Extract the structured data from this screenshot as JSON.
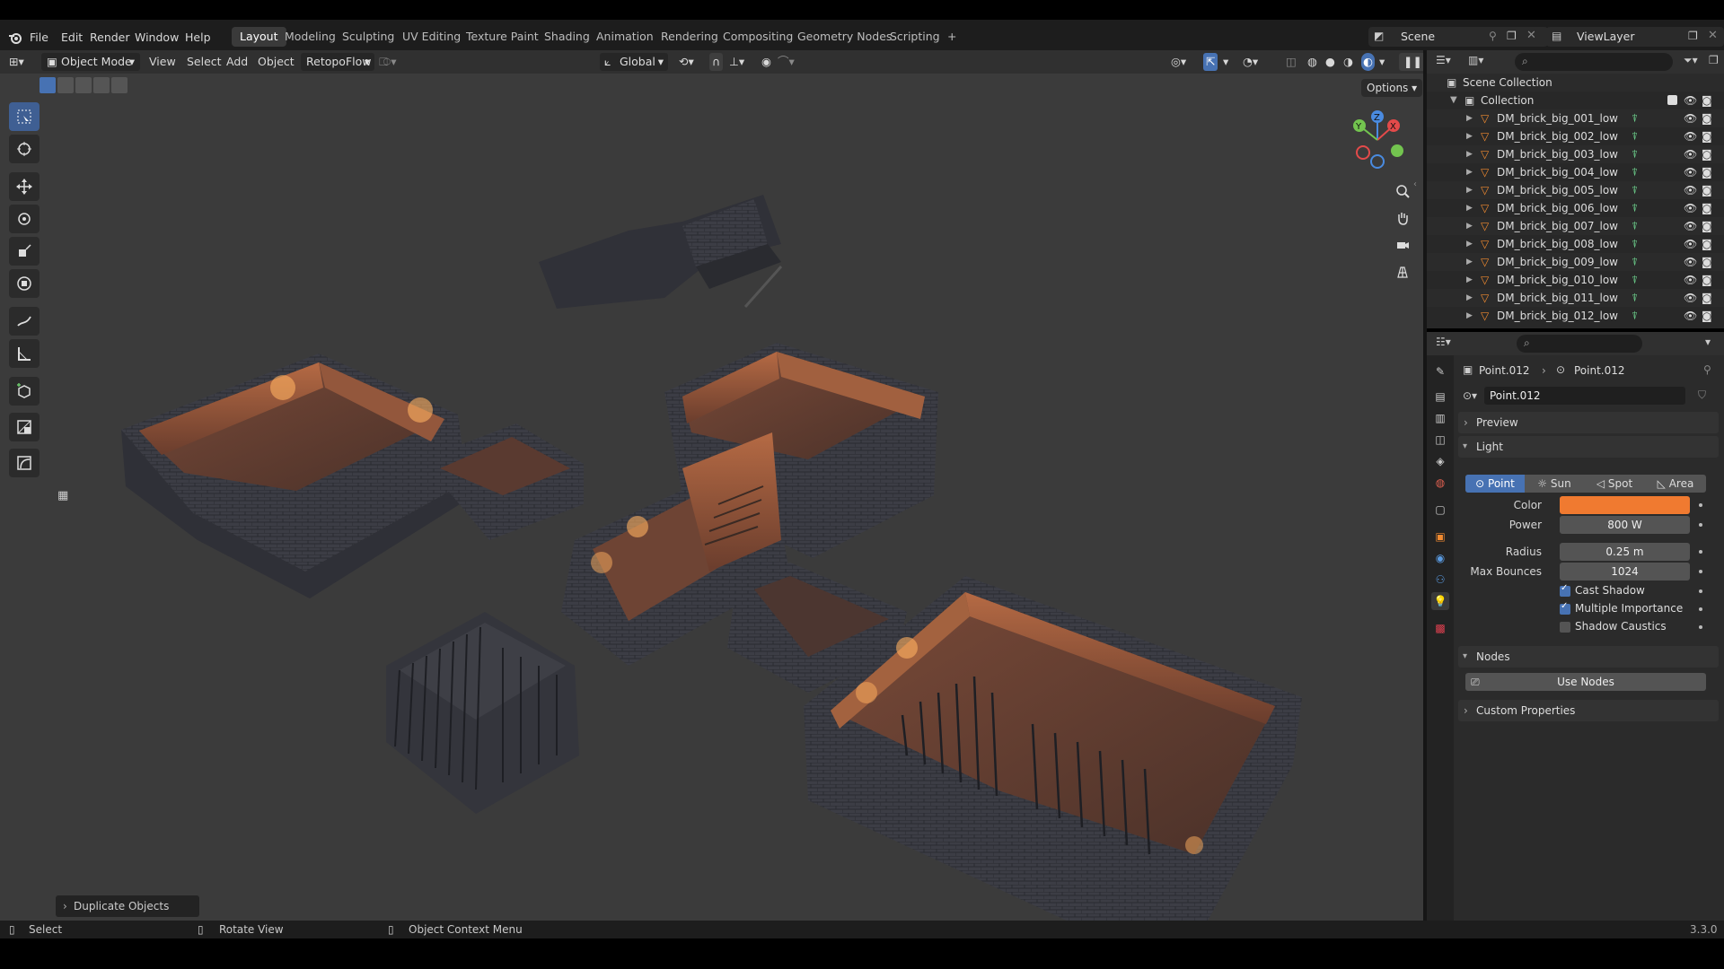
{
  "topbar": {
    "menus": [
      "File",
      "Edit",
      "Render",
      "Window",
      "Help"
    ],
    "workspaces": [
      "Layout",
      "Modeling",
      "Sculpting",
      "UV Editing",
      "Texture Paint",
      "Shading",
      "Animation",
      "Rendering",
      "Compositing",
      "Geometry Nodes",
      "Scripting"
    ],
    "active_workspace": "Layout",
    "add_workspace": "+",
    "scene": "Scene",
    "view_layer": "ViewLayer"
  },
  "viewport_header": {
    "mode": "Object Mode",
    "menus": [
      "View",
      "Select",
      "Add",
      "Object"
    ],
    "addon": "RetopoFlow",
    "orientation": "Global",
    "options": "Options"
  },
  "viewport": {
    "last_operator": "Duplicate Objects",
    "gizmo_axes": [
      "Z",
      "Y",
      "X"
    ]
  },
  "outliner": {
    "scene_collection": "Scene Collection",
    "collection": "Collection",
    "objects": [
      "DM_brick_big_001_low",
      "DM_brick_big_002_low",
      "DM_brick_big_003_low",
      "DM_brick_big_004_low",
      "DM_brick_big_005_low",
      "DM_brick_big_006_low",
      "DM_brick_big_007_low",
      "DM_brick_big_008_low",
      "DM_brick_big_009_low",
      "DM_brick_big_010_low",
      "DM_brick_big_011_low",
      "DM_brick_big_012_low"
    ]
  },
  "properties": {
    "breadcrumb_object": "Point.012",
    "breadcrumb_data": "Point.012",
    "datablock_name": "Point.012",
    "panels": {
      "preview": "Preview",
      "light": "Light",
      "nodes": "Nodes",
      "custom": "Custom Properties"
    },
    "light_types": [
      "Point",
      "Sun",
      "Spot",
      "Area"
    ],
    "active_light_type": "Point",
    "color_label": "Color",
    "color_value": "#f07a30",
    "power_label": "Power",
    "power": "800 W",
    "radius_label": "Radius",
    "radius": "0.25 m",
    "max_bounces_label": "Max Bounces",
    "max_bounces": "1024",
    "cast_shadow": "Cast Shadow",
    "multiple_importance": "Multiple Importance",
    "shadow_caustics": "Shadow Caustics",
    "use_nodes": "Use Nodes"
  },
  "statusbar": {
    "select": "Select",
    "rotate": "Rotate View",
    "context": "Object Context Menu",
    "version": "3.3.0"
  },
  "colors": {
    "accent": "#4772b3",
    "light_color": "#f07a30"
  }
}
